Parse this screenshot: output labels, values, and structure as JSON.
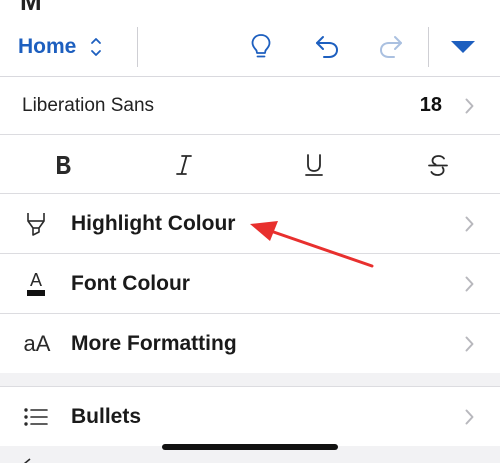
{
  "toolbar": {
    "home_label": "Home",
    "icons": [
      "updown-chevron-icon",
      "lightbulb-icon",
      "undo-icon",
      "redo-icon",
      "dropdown-triangle-icon"
    ],
    "accent_color": "#1d5fbf"
  },
  "font_row": {
    "font_name": "Liberation Sans",
    "font_size": "18"
  },
  "format_buttons": [
    {
      "name": "bold",
      "glyph": "B"
    },
    {
      "name": "italic",
      "glyph": "I"
    },
    {
      "name": "underline",
      "glyph": "U"
    },
    {
      "name": "strikethrough",
      "glyph": "S"
    }
  ],
  "menu_items": [
    {
      "label": "Highlight Colour",
      "icon": "highlighter-icon"
    },
    {
      "label": "Font Colour",
      "icon": "font-colour-icon",
      "icon_glyph": "A"
    },
    {
      "label": "More Formatting",
      "icon": "text-size-icon",
      "icon_glyph": "aA"
    },
    {
      "label": "Bullets",
      "icon": "bullet-list-icon"
    }
  ],
  "annotation": {
    "type": "red-arrow",
    "target": "Highlight Colour",
    "color": "#e8302e"
  }
}
